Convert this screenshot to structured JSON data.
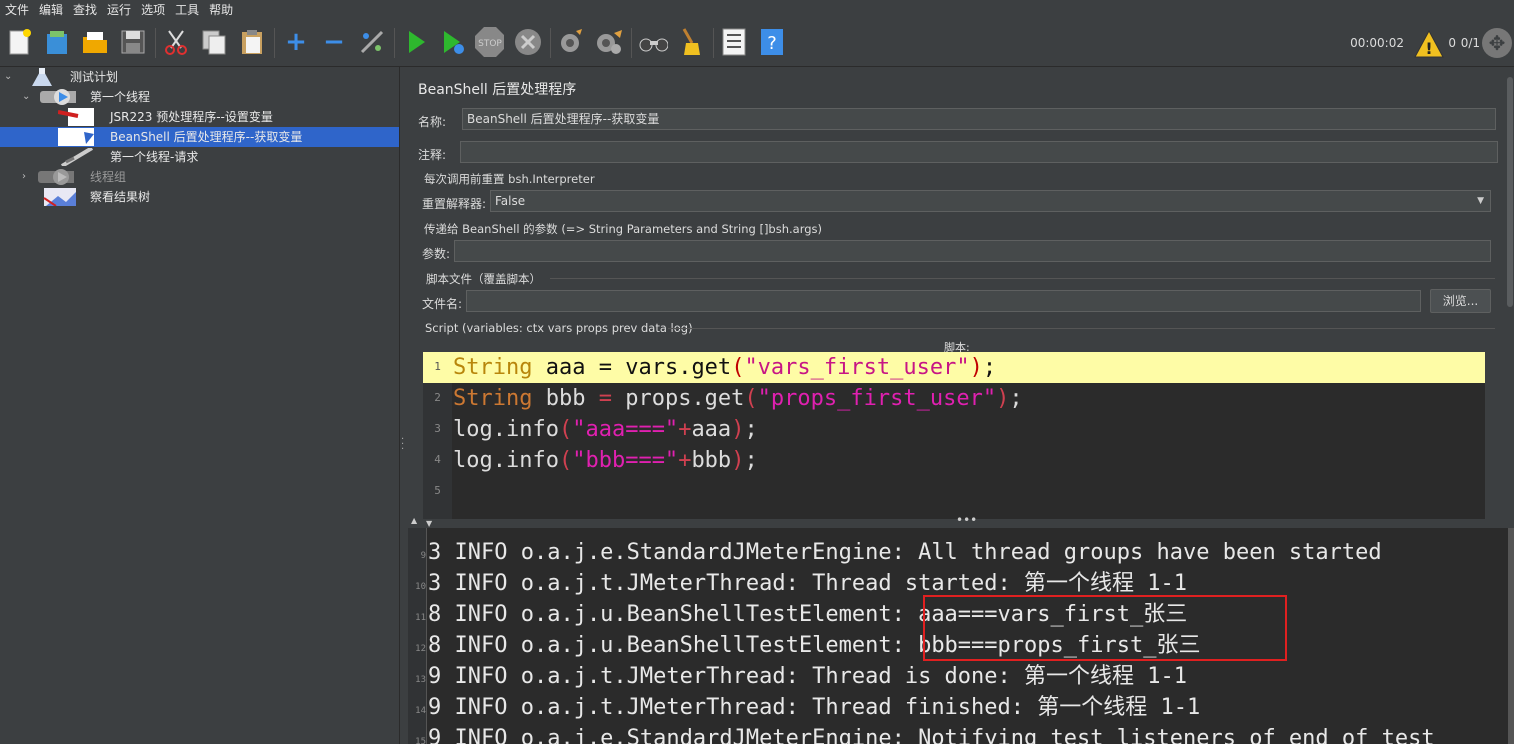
{
  "menu": [
    "文件",
    "编辑",
    "查找",
    "运行",
    "选项",
    "工具",
    "帮助"
  ],
  "toolbar": {
    "timer": "00:00:02",
    "error_count": "0",
    "thread_count": "0/1",
    "icons": [
      "new-icon",
      "templates-icon",
      "open-icon",
      "save-icon",
      "cut-icon",
      "copy-icon",
      "paste-icon",
      "expand-icon",
      "collapse-icon",
      "toggle-icon",
      "start-icon",
      "start-no-pause-icon",
      "stop-icon",
      "shutdown-icon",
      "clear-icon",
      "clear-all-icon",
      "search-icon",
      "reset-search-icon",
      "function-helper-icon",
      "help-icon"
    ],
    "stop_label": "STOP"
  },
  "tree": {
    "items": [
      {
        "label": "测试计划"
      },
      {
        "label": "第一个线程"
      },
      {
        "label": "JSR223 预处理程序--设置变量"
      },
      {
        "label": "BeanShell 后置处理程序--获取变量"
      },
      {
        "label": "第一个线程-请求"
      },
      {
        "label": "线程组"
      },
      {
        "label": "察看结果树"
      }
    ]
  },
  "panel": {
    "title": "BeanShell 后置处理程序",
    "name_label": "名称:",
    "name_value": "BeanShell 后置处理程序--获取变量",
    "comment_label": "注释:",
    "comment_value": "",
    "reset_group": "每次调用前重置 bsh.Interpreter",
    "reset_label": "重置解释器:",
    "reset_value": "False",
    "params_group": "传递给 BeanShell 的参数 (=> String Parameters and String []bsh.args)",
    "params_label": "参数:",
    "params_value": "",
    "file_group": "脚本文件（覆盖脚本）",
    "file_label": "文件名:",
    "file_value": "",
    "browse_label": "浏览...",
    "script_group": "Script (variables: ctx vars props prev data log)",
    "script_caption": "脚本:"
  },
  "code": {
    "line_numbers": [
      "1",
      "2",
      "3",
      "4",
      "5"
    ],
    "line1": {
      "kw": "String",
      "a": " aaa ",
      "eq": "=",
      "b": " vars.get",
      "p1": "(",
      "s": "\"vars_first_user\"",
      "p2": ")",
      "end": ";"
    },
    "line2": {
      "kw": "String",
      "a": " bbb ",
      "eq": "=",
      "b": " props.get",
      "p1": "(",
      "s": "\"props_first_user\"",
      "p2": ")",
      "end": ";"
    },
    "line3": {
      "a": "log.info",
      "p1": "(",
      "s": "\"aaa===\"",
      "plus": "+",
      "b": "aaa",
      "p2": ")",
      "end": ";"
    },
    "line4": {
      "a": "log.info",
      "p1": "(",
      "s": "\"bbb===\"",
      "plus": "+",
      "b": "bbb",
      "p2": ")",
      "end": ";"
    }
  },
  "log": {
    "lines": [
      {
        "n": "9",
        "text": "3 INFO o.a.j.e.StandardJMeterEngine: All thread groups have been started"
      },
      {
        "n": "10",
        "text": "3 INFO o.a.j.t.JMeterThread: Thread started: 第一个线程 1-1"
      },
      {
        "n": "11",
        "text": "8 INFO o.a.j.u.BeanShellTestElement: aaa===vars_first_张三"
      },
      {
        "n": "12",
        "text": "8 INFO o.a.j.u.BeanShellTestElement: bbb===props_first_张三"
      },
      {
        "n": "13",
        "text": "9 INFO o.a.j.t.JMeterThread: Thread is done: 第一个线程 1-1"
      },
      {
        "n": "14",
        "text": "9 INFO o.a.j.t.JMeterThread: Thread finished: 第一个线程 1-1"
      },
      {
        "n": "15",
        "text": "9 INFO o.a.j.e.StandardJMeterEngine: Notifying test listeners of end of test"
      }
    ]
  }
}
